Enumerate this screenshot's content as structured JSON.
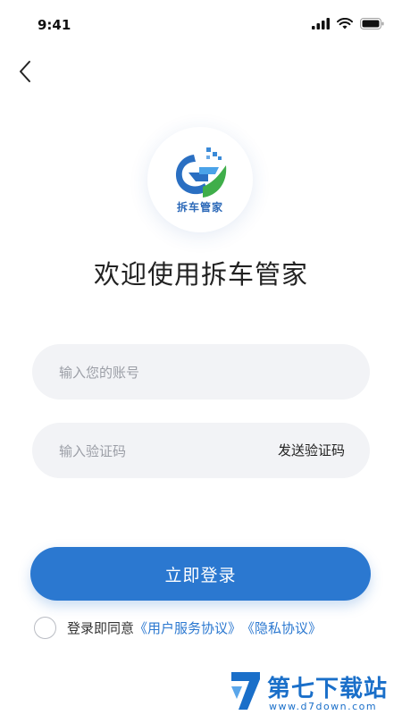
{
  "status_bar": {
    "time": "9:41"
  },
  "logo": {
    "text": "拆车管家"
  },
  "welcome": {
    "title": "欢迎使用拆车管家"
  },
  "form": {
    "account_placeholder": "输入您的账号",
    "code_placeholder": "输入验证码",
    "send_code_label": "发送验证码",
    "login_label": "立即登录"
  },
  "agreement": {
    "prefix": "登录即同意",
    "user_agreement": "《用户服务协议》",
    "privacy_policy": "《隐私协议》"
  },
  "watermark": {
    "title": "第七下载站",
    "url": "www.d7down.com"
  },
  "colors": {
    "accent": "#2b78d0",
    "field_bg": "#f2f3f6"
  }
}
